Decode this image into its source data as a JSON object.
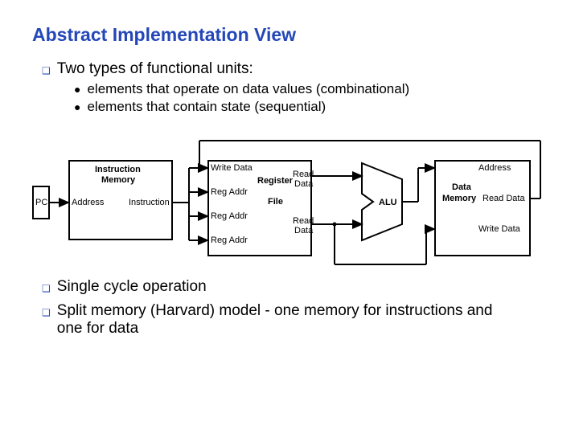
{
  "title": "Abstract Implementation View",
  "bullets": {
    "b1": "Two types of functional units:",
    "b1a": "elements that operate on data values (combinational)",
    "b1b": "elements that contain state (sequential)",
    "b2": "Single cycle operation",
    "b3": "Split memory (Harvard) model - one memory for instructions and one for data"
  },
  "diagram": {
    "pc": "PC",
    "imem_l1": "Instruction",
    "imem_l2": "Memory",
    "imem_addr": "Address",
    "imem_instr": "Instruction",
    "rf_wd": "Write Data",
    "rf_ra1": "Reg Addr",
    "rf_ra2": "Reg Addr",
    "rf_ra3": "Reg Addr",
    "rf_reg": "Register",
    "rf_file": "File",
    "rf_rd1a": "Read",
    "rf_rd1b": "Data",
    "rf_rd2a": "Read",
    "rf_rd2b": "Data",
    "alu": "ALU",
    "dmem_addr": "Address",
    "dmem_l1": "Data",
    "dmem_l2": "Memory",
    "dmem_rd": "Read Data",
    "dmem_wd": "Write Data"
  }
}
